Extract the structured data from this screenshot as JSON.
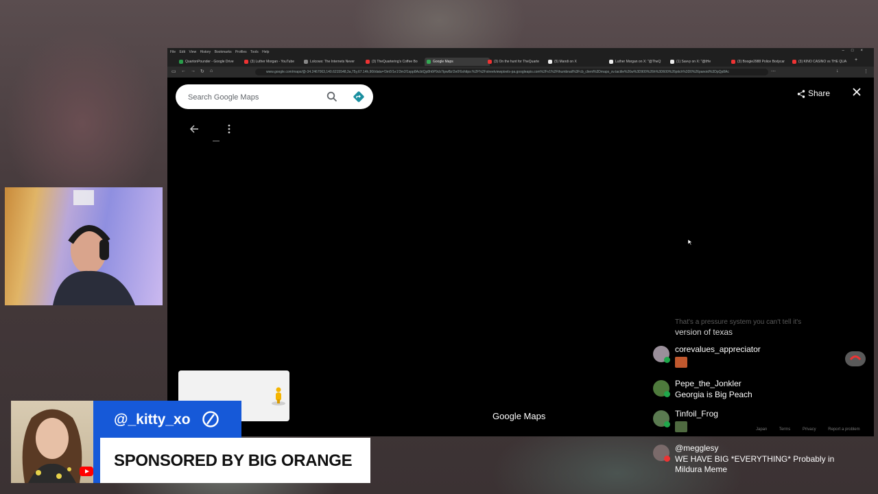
{
  "browser": {
    "menu": [
      "File",
      "Edit",
      "View",
      "History",
      "Bookmarks",
      "Profiles",
      "Tools",
      "Help"
    ],
    "tabs": [
      {
        "label": "QuartonPounder - Google Drive"
      },
      {
        "label": "(3) Luther Morgan - YouTube"
      },
      {
        "label": "Lolcows: The Internets Never"
      },
      {
        "label": "(3) TheQuartering's Coffee Bo"
      },
      {
        "label": "Google Maps"
      },
      {
        "label": "(3) On the hunt for TheQuarte"
      },
      {
        "label": "(5) Mandi on X"
      },
      {
        "label": "Luther Morgan on X: \"@TheQ"
      },
      {
        "label": "(1) Savvy on X: \"@tHe"
      },
      {
        "label": "(3) Boogie2988 Police Bodycar"
      },
      {
        "label": "(3) KINO CASINO vs THE QUA"
      }
    ],
    "url": "www.google.com/maps/@-34.2467063,140.6215548,3a,75y,67.14h,90t/data=!3m5!1e1!3m3!1spp8AcbtQp8h6P9cb7tpwBz!2e0!6shttps:%2F%2Fstreetviewpixels-pa.googleapis.com%2Fv1%2Fthumbnail%3Fcb_client%3Dmaps_sv.tactile%26w%3D900%26h%3D600%26pitch%3D0%26panoid%3DpQp8Ac"
  },
  "maps": {
    "search_placeholder": "Search Google Maps",
    "share_label": "Share",
    "logo_text": "Google Maps",
    "footer": [
      "Japan",
      "Terms",
      "Privacy",
      "Report a problem"
    ]
  },
  "chat": {
    "faded_line1": "That's a pressure system you can't tell it's",
    "faded_line2": "version of texas",
    "messages": [
      {
        "author": "corevalues_appreciator",
        "text": ""
      },
      {
        "author": "Pepe_the_Jonkler",
        "text": "Georgia is Big Peach"
      },
      {
        "author": "Tinfoil_Frog",
        "text": ""
      },
      {
        "author": "@megglesy",
        "text": "WE HAVE BIG *EVERYTHING* Probably in Mildura Meme"
      }
    ]
  },
  "overlay": {
    "username": "@_kitty_xo",
    "sponsor": "SPONSORED BY BIG ORANGE"
  },
  "colors": {
    "banner_blue": "#1659d8",
    "maps_black": "#000000",
    "directions_teal": "#1a73e8"
  }
}
